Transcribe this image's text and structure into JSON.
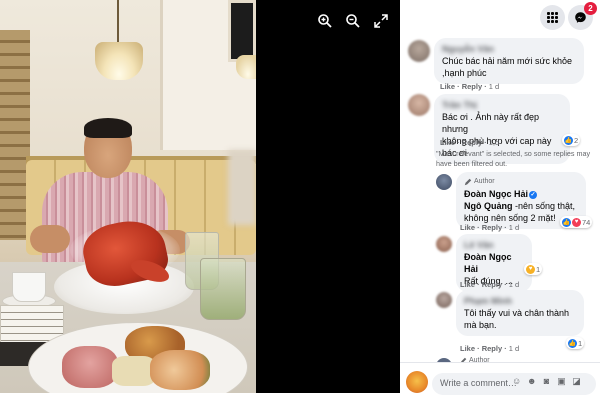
{
  "viewer": {
    "tools": [
      "zoom-in-icon",
      "zoom-out-icon",
      "fullscreen-icon"
    ]
  },
  "header": {
    "menu_icon": "grid-menu-icon",
    "messenger_icon": "messenger-icon",
    "messenger_badge": "2"
  },
  "comments": [
    {
      "text": "Chúc bác hải năm mới sức khỏe ,hạnh phúc",
      "like": "Like",
      "reply": "Reply",
      "time": "1 d"
    },
    {
      "text_line1": "Bác ơi . Ảnh này rất đẹp nhưng",
      "text_line2": "không phù hợp với cap này bác ơi",
      "like": "Like",
      "reply": "Reply",
      "time": "1 d",
      "reactions": "2"
    }
  ],
  "filter_notice": "\"Most relevant\" is selected, so some replies may have been filtered out.",
  "replies": [
    {
      "badge": "Author",
      "name": "Đoàn Ngọc Hải",
      "tag": "Ngô Quảng",
      "text_line1": " -nên sống thật,",
      "text_line2": "không nên sống 2 mặt!",
      "like": "Like",
      "reply": "Reply",
      "time": "1 d",
      "reactions": "74"
    },
    {
      "tag": "Đoàn Ngọc Hải",
      "text": "Rất đúng. ...",
      "like": "Like",
      "reply": "Reply",
      "time": "1 d",
      "reactions": "1"
    },
    {
      "text_line1": "Tôi thấy vui và chân thành",
      "text_line2": "mà bạn.",
      "like": "Like",
      "reply": "Reply",
      "time": "1 d",
      "reactions": "1"
    }
  ],
  "last_author_badge": "Author",
  "composer": {
    "placeholder": "Write a comment…"
  },
  "colors": {
    "accent": "#1877f2",
    "badge": "#e41e3f",
    "bubble": "#f0f2f5",
    "secondary_text": "#65676b"
  }
}
